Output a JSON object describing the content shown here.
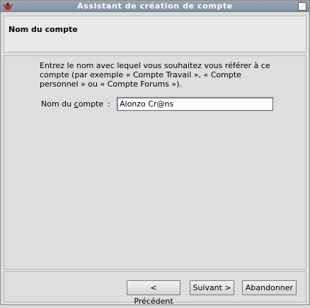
{
  "window": {
    "title": "Assistant de création de compte",
    "icon": "app-bug-icon",
    "close_icon": "close-icon"
  },
  "header": {
    "title": "Nom du compte"
  },
  "content": {
    "description": "Entrez le nom avec lequel vous souhaitez vous référer à ce compte (par exemple « Compte Travail », « Compte personnel » ou « Compte Forums »).",
    "field": {
      "label_before": "Nom du ",
      "label_underlined": "c",
      "label_after": "ompte",
      "colon": ":",
      "value": "Alonzo Cr@ns"
    }
  },
  "footer": {
    "prev_label": "< Précédent",
    "next_label": "Suivant >",
    "cancel_label": "Abandonner"
  },
  "colors": {
    "titlebar": "#8290a2",
    "background": "#dedede"
  }
}
